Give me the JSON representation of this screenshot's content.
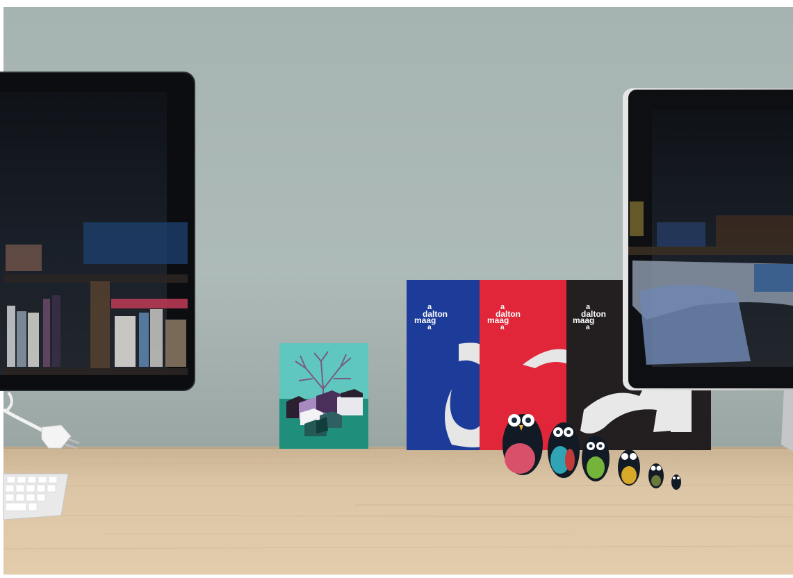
{
  "scene": {
    "description_labels": {
      "magazine_brand_line1": "a",
      "magazine_brand_line2": "dalton",
      "magazine_brand_line3": "maag",
      "magazine_brand_line4": "a"
    },
    "colors": {
      "wall": "#a9b7b4",
      "desk": "#d9c3a3",
      "monitor_screen": "#151a22",
      "magazine_blue": "#1b3a9a",
      "magazine_red": "#e0253a",
      "magazine_black": "#231f20",
      "postcard_teal": "#2aa894"
    },
    "objects": [
      "left-monitor",
      "right-monitor",
      "postcard",
      "magazine-blue",
      "magazine-red",
      "magazine-black",
      "owl-nesting-dolls",
      "keyboard",
      "power-plug",
      "desk"
    ]
  }
}
